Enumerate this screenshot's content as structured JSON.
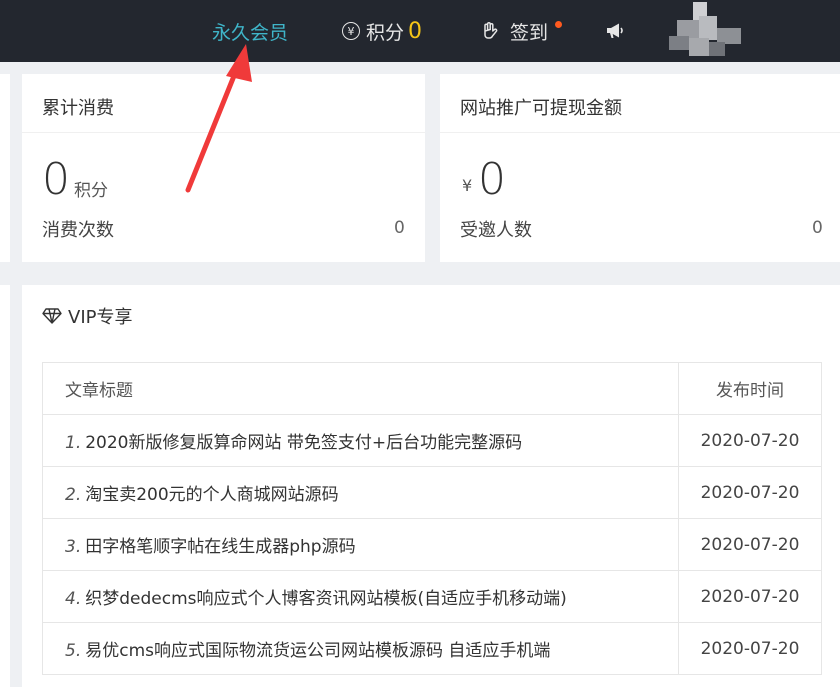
{
  "nav": {
    "member_label": "永久会员",
    "points_icon": "yen-circle-icon",
    "points_yen": "¥",
    "points_label": "积分",
    "points_value": "0",
    "checkin_label": "签到",
    "checkin_icon": "hand-icon",
    "announce_icon": "megaphone-icon"
  },
  "consume_card": {
    "title": "累计消费",
    "value": "0",
    "unit": "积分",
    "count_label": "消费次数",
    "count_value": "0"
  },
  "promo_card": {
    "title": "网站推广可提现金额",
    "currency": "¥",
    "value": "0",
    "invite_label": "受邀人数",
    "invite_value": "0"
  },
  "vip": {
    "title": "VIP专享",
    "icon": "diamond-icon",
    "columns": [
      "文章标题",
      "发布时间"
    ],
    "rows": [
      {
        "num": "1.",
        "title": "2020新版修复版算命网站 带免签支付+后台功能完整源码",
        "date": "2020-07-20"
      },
      {
        "num": "2.",
        "title": "淘宝卖200元的个人商城网站源码",
        "date": "2020-07-20"
      },
      {
        "num": "3.",
        "title": "田字格笔顺字帖在线生成器php源码",
        "date": "2020-07-20"
      },
      {
        "num": "4.",
        "title": "织梦dedecms响应式个人博客资讯网站模板(自适应手机移动端)",
        "date": "2020-07-20"
      },
      {
        "num": "5.",
        "title": "易优cms响应式国际物流货运公司网站模板源码 自适应手机端",
        "date": "2020-07-20"
      }
    ]
  },
  "colors": {
    "topbar_bg": "#23272f",
    "member_accent": "#3fb5c9",
    "points_accent": "#f5c518",
    "badge_dot": "#ff5a1f",
    "arrow": "#f03a3a"
  }
}
